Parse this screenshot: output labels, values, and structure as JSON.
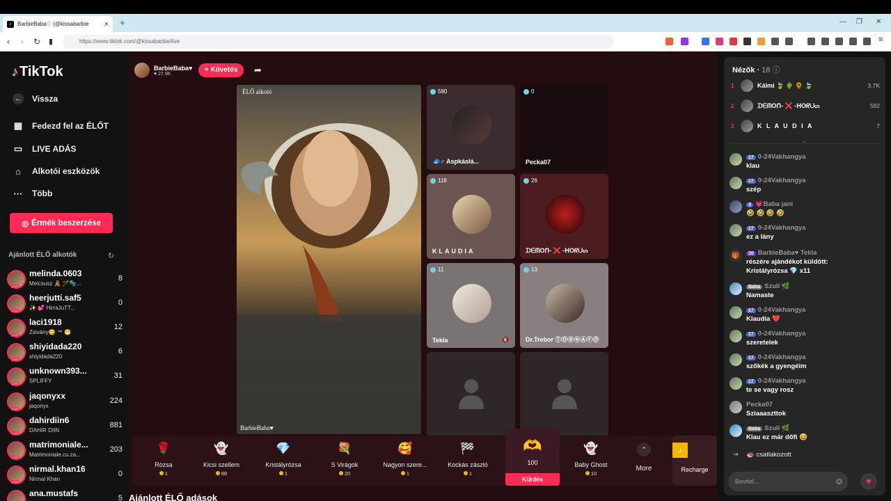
{
  "browser": {
    "tab_title": "BarbieBaba♡ (@kissabarbie",
    "url": "https://www.tiktok.com/@kissabarbie/live"
  },
  "sidebar": {
    "logo": "TikTok",
    "back": "Vissza",
    "items": [
      {
        "label": "Fedezd fel az ÉLŐT",
        "icon": "calendar-icon"
      },
      {
        "label": "LIVE ADÁS",
        "icon": "video-icon"
      },
      {
        "label": "Alkotói eszközök",
        "icon": "lightbulb-icon"
      },
      {
        "label": "Több",
        "icon": "more-icon"
      }
    ],
    "coins_button": "Érmék beszerzése",
    "suggested_title": "Ajánlott ÉLŐ alkotók",
    "creators": [
      {
        "name": "melinda.0603",
        "sub": "Melcsusz 🧸 🪄🫧...",
        "count": "8"
      },
      {
        "name": "heerjutti.saf5",
        "sub": "✨ 💕 HirraJuTT...",
        "count": "0"
      },
      {
        "name": "laci1918",
        "sub": "Zsivány😋 ™ 😁",
        "count": "12"
      },
      {
        "name": "shiyidada220",
        "sub": "shiyidada220",
        "count": "6"
      },
      {
        "name": "unknown393...",
        "sub": "SPLIFFY",
        "count": "31"
      },
      {
        "name": "jaqonyxx",
        "sub": "jaqonyx",
        "count": "224"
      },
      {
        "name": "dahirdiin6",
        "sub": "DAHIR DIIN",
        "count": "881"
      },
      {
        "name": "matrimoniale...",
        "sub": "Matrimoniale.cu.za...",
        "count": "203"
      },
      {
        "name": "nirmal.khan16",
        "sub": "Nirmal Khan",
        "count": "0"
      },
      {
        "name": "ana.mustafs",
        "sub": "",
        "count": "5"
      }
    ]
  },
  "host": {
    "name": "BarbieBaba♥",
    "likes": "27.9K",
    "follow": "+ Követés"
  },
  "main_video": {
    "label": "ÉLŐ alkotó",
    "name": "BarbieBaba♥"
  },
  "guests": [
    {
      "count": "580",
      "name": "🧢♂ Aspkáslá..."
    },
    {
      "count": "0",
      "name": "Pecka07"
    },
    {
      "count": "118",
      "name": "KLAUDIA"
    },
    {
      "count": "26",
      "name": "ᗪᗴᗰOᑎ- ❌ -ᕼOᖇᑌᔕ"
    },
    {
      "count": "11",
      "name": "Tekla"
    },
    {
      "count": "13",
      "name": "Dr.Trebor ⓉⓄⓇⓃⒶⒻⓄ"
    }
  ],
  "gifts": [
    {
      "name": "Rózsa",
      "price": "1",
      "icon": "🌹"
    },
    {
      "name": "Kicsi szellem",
      "price": "88",
      "icon": "👻"
    },
    {
      "name": "Kristályrózsa",
      "price": "1",
      "icon": "💎"
    },
    {
      "name": "S Virágok",
      "price": "20",
      "icon": "💐"
    },
    {
      "name": "Nagyon szere...",
      "price": "1",
      "icon": "🥰"
    },
    {
      "name": "Kockás zászló",
      "price": "1",
      "icon": "🏁"
    },
    {
      "name": "Baby Ghost",
      "price": "10",
      "icon": "👻"
    }
  ],
  "send_gift": {
    "price": "100",
    "label": "Küldés",
    "icon": "🫶"
  },
  "more_label": "More",
  "recharge_label": "Recharge",
  "bottom_title": "Ajánlott ÉLŐ adások",
  "chat": {
    "viewers_label": "Nézők",
    "viewers_count": "18",
    "top": [
      {
        "rank": "1",
        "name": "Kálmi 🍃 🌵 🌻 🍃",
        "value": "3.7K"
      },
      {
        "rank": "2",
        "name": "ᗪᗴᗰOᑎ- ❌ -ᕼOᖇᑌᔕ",
        "value": "592"
      },
      {
        "rank": "3",
        "name": "K L A U D I A",
        "value": "7"
      }
    ],
    "messages": [
      {
        "badge": "17",
        "user": "0-24Vakhangya",
        "text": "klau"
      },
      {
        "badge": "17",
        "user": "0-24Vakhangya",
        "text": "szép"
      },
      {
        "badge": "3",
        "user": "💗Baba  jani",
        "text": "🤣 🤣 🤣 🤣"
      },
      {
        "badge": "17",
        "user": "0-24Vakhangya",
        "text": "ez a lány"
      },
      {
        "badge": "30",
        "user": "BarbieBaba♥  Tekla",
        "text": "részére ajándékot küldött:"
      },
      {
        "badge": "",
        "user": "",
        "text": "Kristályrózsa 💎 x11"
      },
      {
        "badge": "Baba",
        "user": "Szuli 🌿",
        "text": "Namaste"
      },
      {
        "badge": "17",
        "user": "0-24Vakhangya",
        "text": "Klaudia ❤️"
      },
      {
        "badge": "17",
        "user": "0-24Vakhangya",
        "text": "szeretelek"
      },
      {
        "badge": "17",
        "user": "0-24Vakhangya",
        "text": "szőkék a gyengéim"
      },
      {
        "badge": "17",
        "user": "0-24Vakhangya",
        "text": "te se vagy rosz"
      },
      {
        "badge": "",
        "user": "Pecka07",
        "text": "Sziaaaszttok"
      },
      {
        "badge": "Baba",
        "user": "Szuli 🌿",
        "text": "Klau ez már dőfi 😆"
      }
    ],
    "join_text": "🦔  csatlakozott",
    "input_placeholder": "Bevitel..."
  }
}
